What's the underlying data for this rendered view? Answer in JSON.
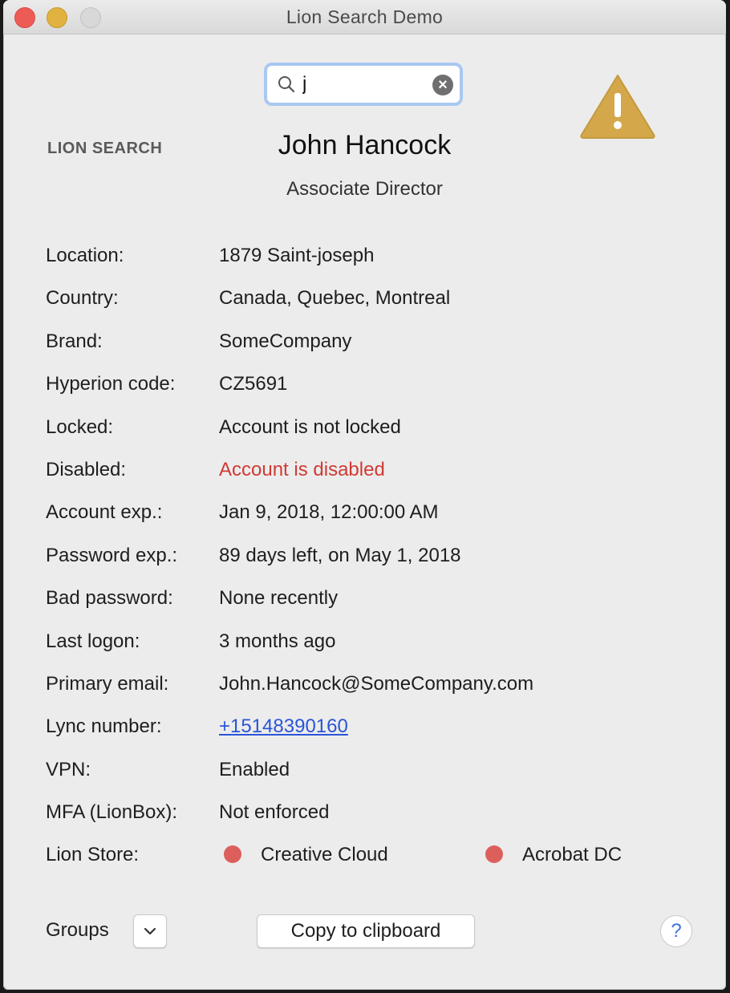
{
  "window": {
    "title": "Lion Search Demo"
  },
  "search": {
    "value": "j",
    "icon": "search-icon",
    "clear_icon": "clear-icon"
  },
  "header": {
    "brand": "LION SEARCH",
    "name": "John Hancock",
    "job_title": "Associate Director",
    "warning_icon": "warning-icon"
  },
  "details": [
    {
      "label": "Location:",
      "value": "1879 Saint-joseph",
      "style": "normal"
    },
    {
      "label": "Country:",
      "value": "Canada, Quebec, Montreal",
      "style": "normal"
    },
    {
      "label": "Brand:",
      "value": "SomeCompany",
      "style": "normal"
    },
    {
      "label": "Hyperion code:",
      "value": "CZ5691",
      "style": "normal"
    },
    {
      "label": "Locked:",
      "value": "Account is not locked",
      "style": "normal"
    },
    {
      "label": "Disabled:",
      "value": "Account is disabled",
      "style": "danger"
    },
    {
      "label": "Account exp.:",
      "value": "Jan 9, 2018, 12:00:00 AM",
      "style": "normal"
    },
    {
      "label": "Password exp.:",
      "value": "89 days left, on May 1, 2018",
      "style": "normal"
    },
    {
      "label": "Bad password:",
      "value": "None recently",
      "style": "normal"
    },
    {
      "label": "Last logon:",
      "value": "3 months ago",
      "style": "normal"
    },
    {
      "label": "Primary email:",
      "value": "John.Hancock@SomeCompany.com",
      "style": "normal"
    },
    {
      "label": "Lync number:",
      "value": "+15148390160",
      "style": "link"
    },
    {
      "label": "VPN:",
      "value": "Enabled",
      "style": "normal"
    },
    {
      "label": "MFA (LionBox):",
      "value": "Not enforced",
      "style": "normal"
    }
  ],
  "lion_store": {
    "label": "Lion Store:",
    "items": [
      {
        "name": "Creative Cloud",
        "status_color": "#dd5f5c"
      },
      {
        "name": "Acrobat DC",
        "status_color": "#dd5f5c"
      }
    ]
  },
  "footer": {
    "groups_label": "Groups",
    "copy_label": "Copy to clipboard",
    "help_label": "?"
  },
  "colors": {
    "danger": "#d03a34",
    "link": "#2a55d8",
    "warning": "#d4a84a",
    "focus_ring": "#a9c8f2"
  }
}
